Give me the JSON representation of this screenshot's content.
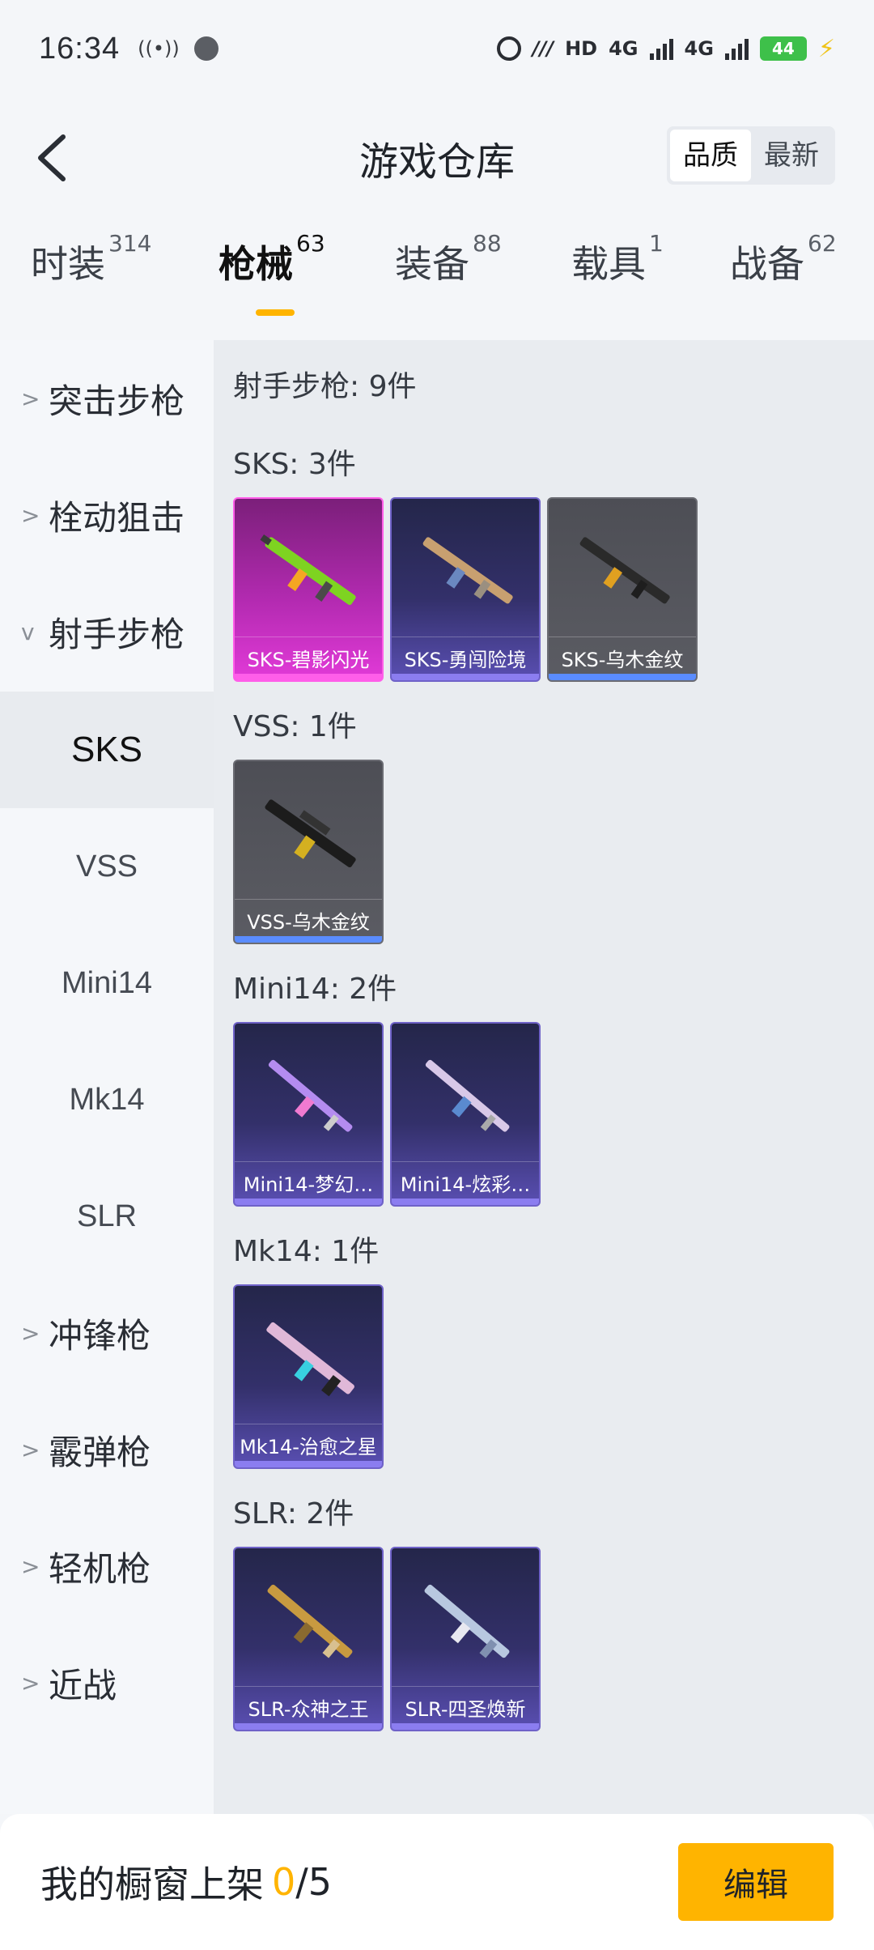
{
  "status_bar": {
    "time": "16:34",
    "network_4g_1": "4G",
    "network_4g_2": "4G",
    "hd_label": "HD",
    "battery": "44"
  },
  "header": {
    "title": "游戏仓库",
    "sort_options": [
      "品质",
      "最新"
    ]
  },
  "category_tabs": [
    {
      "label": "时装",
      "count": "314"
    },
    {
      "label": "枪械",
      "count": "63"
    },
    {
      "label": "装备",
      "count": "88"
    },
    {
      "label": "载具",
      "count": "1"
    },
    {
      "label": "战备",
      "count": "62"
    }
  ],
  "sidebar": {
    "groups": [
      {
        "label": "突击步枪"
      },
      {
        "label": "栓动狙击"
      },
      {
        "label": "射手步枪"
      }
    ],
    "subitems": [
      {
        "label": "SKS"
      },
      {
        "label": "VSS"
      },
      {
        "label": "Mini14"
      },
      {
        "label": "Mk14"
      },
      {
        "label": "SLR"
      }
    ],
    "more_groups": [
      {
        "label": "冲锋枪"
      },
      {
        "label": "霰弹枪"
      },
      {
        "label": "轻机枪"
      },
      {
        "label": "近战"
      }
    ]
  },
  "content": {
    "summary": "射手步枪: 9件",
    "sections": [
      {
        "title": "SKS: 3件",
        "items": [
          {
            "name": "SKS-碧影闪光",
            "rarity": "pink"
          },
          {
            "name": "SKS-勇闯险境",
            "rarity": "purple"
          },
          {
            "name": "SKS-乌木金纹",
            "rarity": "gray"
          }
        ]
      },
      {
        "title": "VSS: 1件",
        "items": [
          {
            "name": "VSS-乌木金纹",
            "rarity": "gray"
          }
        ]
      },
      {
        "title": "Mini14: 2件",
        "items": [
          {
            "name": "Mini14-梦幻…",
            "rarity": "purple"
          },
          {
            "name": "Mini14-炫彩…",
            "rarity": "purple"
          }
        ]
      },
      {
        "title": "Mk14: 1件",
        "items": [
          {
            "name": "Mk14-治愈之星",
            "rarity": "purple"
          }
        ]
      },
      {
        "title": "SLR: 2件",
        "items": [
          {
            "name": "SLR-众神之王",
            "rarity": "purple"
          },
          {
            "name": "SLR-四圣焕新",
            "rarity": "purple"
          }
        ]
      }
    ]
  },
  "bottom_bar": {
    "label": "我的橱窗上架",
    "current": "0",
    "separator": "/",
    "total": "5",
    "edit_label": "编辑"
  }
}
